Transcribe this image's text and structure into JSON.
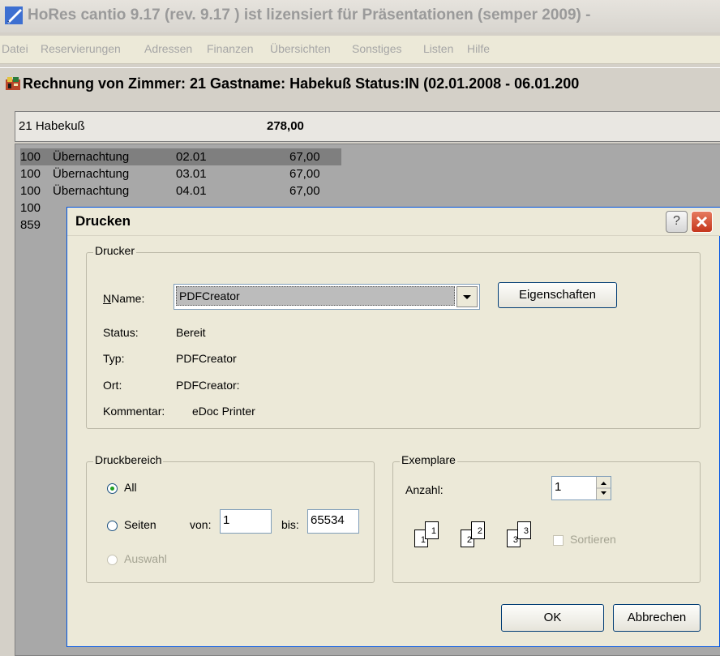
{
  "app": {
    "title": "HoRes cantio 9.17  (rev. 9.17 )  ist lizensiert für Präsentationen (semper 2009) -"
  },
  "menu": [
    "Datei",
    "Reservierungen",
    "Adressen",
    "Finanzen",
    "Übersichten",
    "Sonstiges",
    "Listen",
    "Hilfe"
  ],
  "invoice": {
    "title": "Rechnung von Zimmer: 21 Gastname: Habekuß Status:IN (02.01.2008 - 06.01.200",
    "summary_name": "21 Habekuß",
    "summary_total": "278,00",
    "rows": [
      {
        "code": "100",
        "desc": "Übernachtung",
        "date": "02.01",
        "amount": "67,00"
      },
      {
        "code": "100",
        "desc": "Übernachtung",
        "date": "03.01",
        "amount": "67,00"
      },
      {
        "code": "100",
        "desc": "Übernachtung",
        "date": "04.01",
        "amount": "67,00"
      },
      {
        "code": "100",
        "desc": "",
        "date": "",
        "amount": ""
      },
      {
        "code": "859",
        "desc": "",
        "date": "",
        "amount": ""
      }
    ]
  },
  "dialog": {
    "title": "Drucken",
    "help": "?",
    "printer": {
      "group": "Drucker",
      "name_label": "Name:",
      "name_value": "PDFCreator",
      "properties_button": "Eigenschaften",
      "status_label": "Status:",
      "status_value": "Bereit",
      "type_label": "Typ:",
      "type_value": "PDFCreator",
      "location_label": "Ort:",
      "location_value": "PDFCreator:",
      "comment_label": "Kommentar:",
      "comment_value": "eDoc Printer"
    },
    "range": {
      "group": "Druckbereich",
      "all": "All",
      "pages": "Seiten",
      "from_label": "von:",
      "from_value": "1",
      "to_label": "bis:",
      "to_value": "65534",
      "selection": "Auswahl"
    },
    "copies": {
      "group": "Exemplare",
      "count_label": "Anzahl:",
      "count_value": "1",
      "collate": "Sortieren"
    },
    "ok": "OK",
    "cancel": "Abbrechen"
  }
}
